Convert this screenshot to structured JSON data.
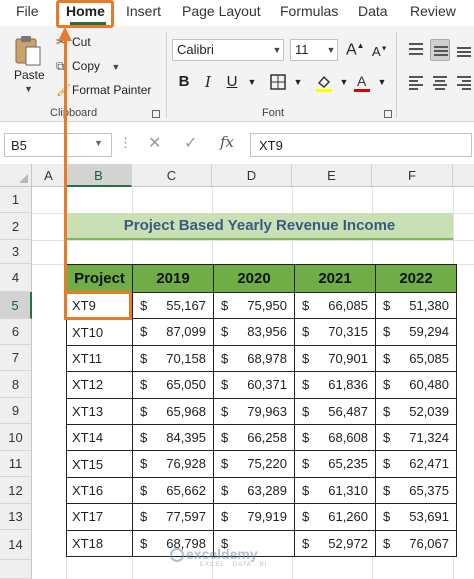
{
  "ribbon_tabs": [
    "File",
    "Home",
    "Insert",
    "Page Layout",
    "Formulas",
    "Data",
    "Review"
  ],
  "clipboard": {
    "paste": "Paste",
    "cut": "Cut",
    "copy": "Copy",
    "format_painter": "Format Painter",
    "group_label": "Clipboard"
  },
  "font": {
    "name": "Calibri",
    "size": "11",
    "group_label": "Font",
    "bold": "B",
    "italic": "I",
    "underline": "U"
  },
  "name_box": "B5",
  "formula": "XT9",
  "fx": "fx",
  "columns": [
    "A",
    "B",
    "C",
    "D",
    "E",
    "F"
  ],
  "rows": [
    "1",
    "2",
    "3",
    "4",
    "5",
    "6",
    "7",
    "8",
    "9",
    "10",
    "11",
    "12",
    "13",
    "14"
  ],
  "sheet_title": "Project Based Yearly Revenue Income",
  "table": {
    "headers": [
      "Project",
      "2019",
      "2020",
      "2021",
      "2022"
    ],
    "currency": "$",
    "rows": [
      [
        "XT9",
        "55,167",
        "75,950",
        "66,085",
        "51,380"
      ],
      [
        "XT10",
        "87,099",
        "83,956",
        "70,315",
        "59,294"
      ],
      [
        "XT11",
        "70,158",
        "68,978",
        "70,901",
        "65,085"
      ],
      [
        "XT12",
        "65,050",
        "60,371",
        "61,836",
        "60,480"
      ],
      [
        "XT13",
        "65,968",
        "79,963",
        "56,487",
        "52,039"
      ],
      [
        "XT14",
        "84,395",
        "66,258",
        "68,608",
        "71,324"
      ],
      [
        "XT15",
        "76,928",
        "75,220",
        "65,235",
        "62,471"
      ],
      [
        "XT16",
        "65,662",
        "63,289",
        "61,310",
        "65,375"
      ],
      [
        "XT17",
        "77,597",
        "79,919",
        "61,260",
        "53,691"
      ],
      [
        "XT18",
        "68,798",
        "",
        "52,972",
        "76,067"
      ]
    ]
  },
  "watermark": {
    "name": "exceldemy",
    "tagline": "EXCEL · DATA · BI"
  },
  "colors": {
    "accent": "#217346",
    "highlight": "#e87b2a",
    "header_fill": "#70ad47",
    "title_fill": "#c9e0b4"
  }
}
